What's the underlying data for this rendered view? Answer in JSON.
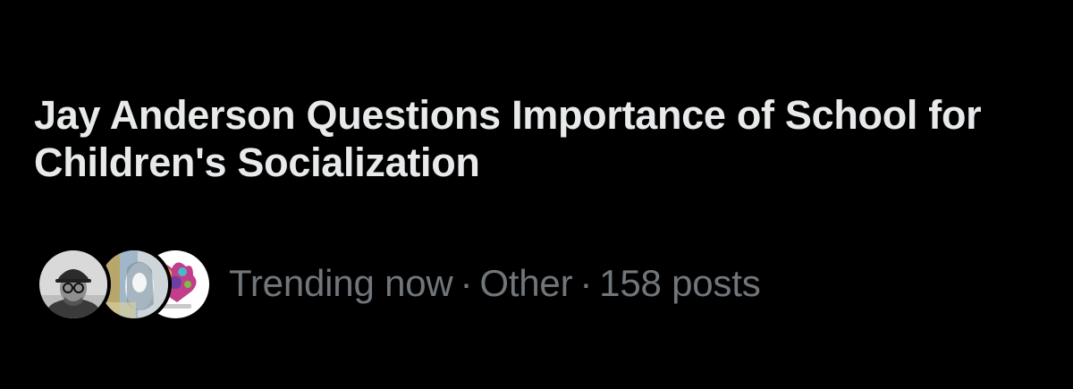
{
  "trend": {
    "headline": "Jay Anderson Questions Importance of School for Children's Socialization",
    "status": "Trending now",
    "separator": "·",
    "category": "Other",
    "post_count": "158 posts"
  },
  "avatars": [
    {
      "icon": "profile-photo-man-with-cap"
    },
    {
      "icon": "profile-photo-artwork"
    },
    {
      "icon": "profile-photo-colorful-logo"
    }
  ],
  "colors": {
    "background": "#000000",
    "headline_text": "#e7e9ea",
    "secondary_text": "#71767b"
  }
}
